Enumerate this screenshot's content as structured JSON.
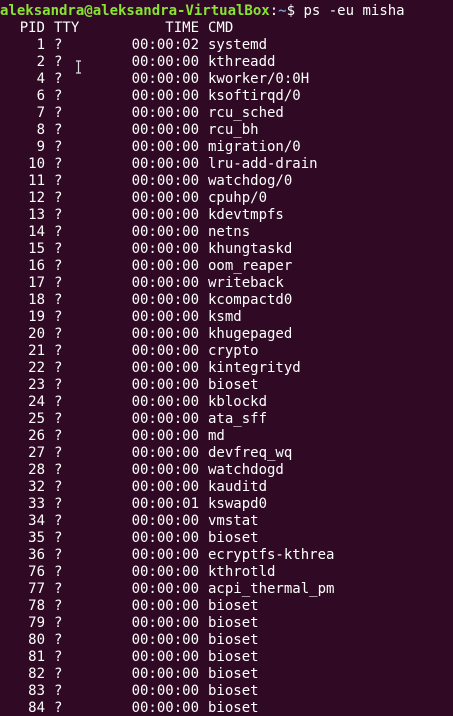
{
  "prompt": {
    "user_host": "aleksandra@aleksandra-VirtualBox",
    "separator": ":",
    "path": "~",
    "symbol": "$",
    "command": " ps -eu misha"
  },
  "header": {
    "pid": "PID",
    "tty": "TTY",
    "time": "TIME",
    "cmd": "CMD"
  },
  "processes": [
    {
      "pid": "1",
      "tty": "?",
      "time": "00:00:02",
      "cmd": "systemd"
    },
    {
      "pid": "2",
      "tty": "?",
      "time": "00:00:00",
      "cmd": "kthreadd"
    },
    {
      "pid": "4",
      "tty": "?",
      "time": "00:00:00",
      "cmd": "kworker/0:0H"
    },
    {
      "pid": "6",
      "tty": "?",
      "time": "00:00:00",
      "cmd": "ksoftirqd/0"
    },
    {
      "pid": "7",
      "tty": "?",
      "time": "00:00:00",
      "cmd": "rcu_sched"
    },
    {
      "pid": "8",
      "tty": "?",
      "time": "00:00:00",
      "cmd": "rcu_bh"
    },
    {
      "pid": "9",
      "tty": "?",
      "time": "00:00:00",
      "cmd": "migration/0"
    },
    {
      "pid": "10",
      "tty": "?",
      "time": "00:00:00",
      "cmd": "lru-add-drain"
    },
    {
      "pid": "11",
      "tty": "?",
      "time": "00:00:00",
      "cmd": "watchdog/0"
    },
    {
      "pid": "12",
      "tty": "?",
      "time": "00:00:00",
      "cmd": "cpuhp/0"
    },
    {
      "pid": "13",
      "tty": "?",
      "time": "00:00:00",
      "cmd": "kdevtmpfs"
    },
    {
      "pid": "14",
      "tty": "?",
      "time": "00:00:00",
      "cmd": "netns"
    },
    {
      "pid": "15",
      "tty": "?",
      "time": "00:00:00",
      "cmd": "khungtaskd"
    },
    {
      "pid": "16",
      "tty": "?",
      "time": "00:00:00",
      "cmd": "oom_reaper"
    },
    {
      "pid": "17",
      "tty": "?",
      "time": "00:00:00",
      "cmd": "writeback"
    },
    {
      "pid": "18",
      "tty": "?",
      "time": "00:00:00",
      "cmd": "kcompactd0"
    },
    {
      "pid": "19",
      "tty": "?",
      "time": "00:00:00",
      "cmd": "ksmd"
    },
    {
      "pid": "20",
      "tty": "?",
      "time": "00:00:00",
      "cmd": "khugepaged"
    },
    {
      "pid": "21",
      "tty": "?",
      "time": "00:00:00",
      "cmd": "crypto"
    },
    {
      "pid": "22",
      "tty": "?",
      "time": "00:00:00",
      "cmd": "kintegrityd"
    },
    {
      "pid": "23",
      "tty": "?",
      "time": "00:00:00",
      "cmd": "bioset"
    },
    {
      "pid": "24",
      "tty": "?",
      "time": "00:00:00",
      "cmd": "kblockd"
    },
    {
      "pid": "25",
      "tty": "?",
      "time": "00:00:00",
      "cmd": "ata_sff"
    },
    {
      "pid": "26",
      "tty": "?",
      "time": "00:00:00",
      "cmd": "md"
    },
    {
      "pid": "27",
      "tty": "?",
      "time": "00:00:00",
      "cmd": "devfreq_wq"
    },
    {
      "pid": "28",
      "tty": "?",
      "time": "00:00:00",
      "cmd": "watchdogd"
    },
    {
      "pid": "32",
      "tty": "?",
      "time": "00:00:00",
      "cmd": "kauditd"
    },
    {
      "pid": "33",
      "tty": "?",
      "time": "00:00:01",
      "cmd": "kswapd0"
    },
    {
      "pid": "34",
      "tty": "?",
      "time": "00:00:00",
      "cmd": "vmstat"
    },
    {
      "pid": "35",
      "tty": "?",
      "time": "00:00:00",
      "cmd": "bioset"
    },
    {
      "pid": "36",
      "tty": "?",
      "time": "00:00:00",
      "cmd": "ecryptfs-kthrea"
    },
    {
      "pid": "76",
      "tty": "?",
      "time": "00:00:00",
      "cmd": "kthrotld"
    },
    {
      "pid": "77",
      "tty": "?",
      "time": "00:00:00",
      "cmd": "acpi_thermal_pm"
    },
    {
      "pid": "78",
      "tty": "?",
      "time": "00:00:00",
      "cmd": "bioset"
    },
    {
      "pid": "79",
      "tty": "?",
      "time": "00:00:00",
      "cmd": "bioset"
    },
    {
      "pid": "80",
      "tty": "?",
      "time": "00:00:00",
      "cmd": "bioset"
    },
    {
      "pid": "81",
      "tty": "?",
      "time": "00:00:00",
      "cmd": "bioset"
    },
    {
      "pid": "82",
      "tty": "?",
      "time": "00:00:00",
      "cmd": "bioset"
    },
    {
      "pid": "83",
      "tty": "?",
      "time": "00:00:00",
      "cmd": "bioset"
    },
    {
      "pid": "84",
      "tty": "?",
      "time": "00:00:00",
      "cmd": "bioset"
    }
  ],
  "colors": {
    "background": "#300a24",
    "prompt_user": "#8ae234",
    "prompt_path": "#729fcf",
    "text": "#ffffff"
  },
  "icons": {
    "mouse_cursor": "ibeam-cursor-icon"
  }
}
